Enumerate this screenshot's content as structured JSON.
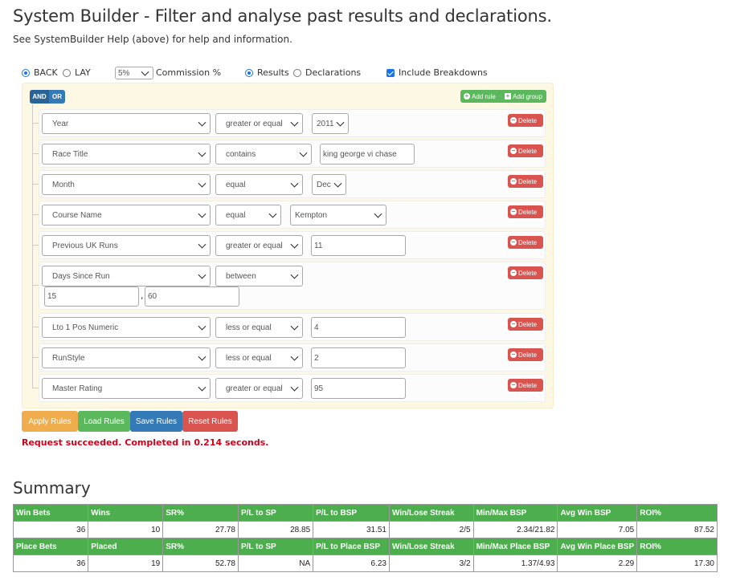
{
  "header": {
    "title": "System Builder - Filter and analyse past results and declarations.",
    "subtitle": "See SystemBuilder Help (above) for help and information."
  },
  "options": {
    "back_label": "BACK",
    "lay_label": "LAY",
    "commission_value": "5%",
    "commission_label": "Commission %",
    "results_label": "Results",
    "declarations_label": "Declarations",
    "breakdowns_label": "Include Breakdowns"
  },
  "builder": {
    "and_label": "AND",
    "or_label": "OR",
    "add_rule_label": "Add rule",
    "add_group_label": "Add group",
    "delete_label": "Delete",
    "rules": [
      {
        "field": "Year",
        "operator": "greater or equal",
        "value": "2011"
      },
      {
        "field": "Race Title",
        "operator": "contains",
        "value": "king george vi chase"
      },
      {
        "field": "Month",
        "operator": "equal",
        "value": "Dec"
      },
      {
        "field": "Course Name",
        "operator": "equal",
        "value": "Kempton"
      },
      {
        "field": "Previous UK Runs",
        "operator": "greater or equal",
        "value": "11"
      },
      {
        "field": "Days Since Run",
        "operator": "between",
        "value": "15",
        "value2": "60",
        "separator": ","
      },
      {
        "field": "Lto 1 Pos Numeric",
        "operator": "less or equal",
        "value": "4"
      },
      {
        "field": "RunStyle",
        "operator": "less or equal",
        "value": "2"
      },
      {
        "field": "Master Rating",
        "operator": "greater or equal",
        "value": "95"
      }
    ]
  },
  "actions": {
    "apply": "Apply Rules",
    "load": "Load Rules",
    "save": "Save Rules",
    "reset": "Reset Rules"
  },
  "status": "Request succeeded. Completed in 0.214 seconds.",
  "summary": {
    "title": "Summary",
    "win_headers": [
      "Win Bets",
      "Wins",
      "SR%",
      "P/L to SP",
      "P/L to BSP",
      "Win/Lose Streak",
      "Min/Max BSP",
      "Avg Win BSP",
      "ROI%"
    ],
    "win_values": [
      "36",
      "10",
      "27.78",
      "28.85",
      "31.51",
      "2/5",
      "2.34/21.82",
      "7.05",
      "87.52"
    ],
    "place_headers": [
      "Place Bets",
      "Placed",
      "SR%",
      "P/L to SP",
      "P/L to Place BSP",
      "Win/Lose Streak",
      "Min/Max Place BSP",
      "Avg Win Place BSP",
      "ROI%"
    ],
    "place_values": [
      "36",
      "19",
      "52.78",
      "NA",
      "6.23",
      "3/2",
      "1.37/4.93",
      "2.29",
      "17.30"
    ]
  },
  "colors": {
    "green": "#5cb85c",
    "blue": "#337ab7",
    "red": "#d9534f",
    "orange": "#f0ad4e",
    "status_red": "#d0021b",
    "builder_bg": "#fcf8e3"
  }
}
